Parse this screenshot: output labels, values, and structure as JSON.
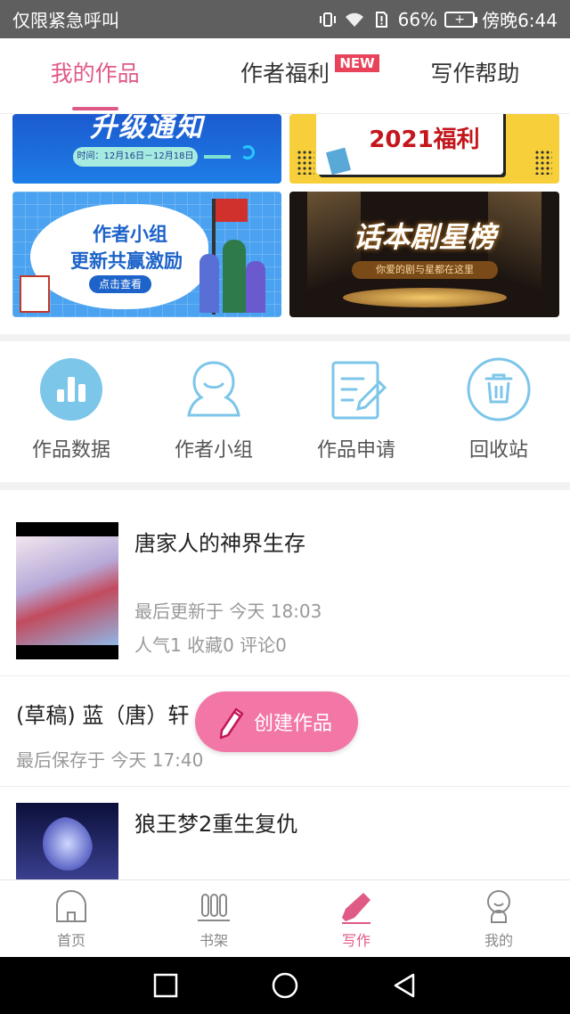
{
  "status_bar": {
    "carrier_text": "仅限紧急呼叫",
    "battery_percent": "66%",
    "time": "傍晚6:44"
  },
  "top_tabs": [
    {
      "label": "我的作品",
      "active": true
    },
    {
      "label": "作者福利",
      "badge": "NEW",
      "active": false
    },
    {
      "label": "写作帮助",
      "active": false
    }
  ],
  "banners": {
    "b1": {
      "title": "升级通知",
      "date": "时间：12月16日－12月18日"
    },
    "b2": {
      "title": "2021福利"
    },
    "b3": {
      "line1": "作者小组",
      "line2": "更新共赢激励",
      "cta": "点击查看"
    },
    "b4": {
      "title": "话本剧星榜",
      "subtitle": "你爱的剧与星都在这里"
    }
  },
  "quick_actions": [
    {
      "label": "作品数据",
      "icon": "bar-chart-icon"
    },
    {
      "label": "作者小组",
      "icon": "person-group-icon"
    },
    {
      "label": "作品申请",
      "icon": "edit-document-icon"
    },
    {
      "label": "回收站",
      "icon": "trash-icon"
    }
  ],
  "works": [
    {
      "title": "唐家人的神界生存",
      "updated": "最后更新于 今天 18:03",
      "stats": "人气1 收藏0 评论0"
    },
    {
      "title": "(草稿) 蓝（唐）轩",
      "updated": "最后保存于 今天 17:40"
    },
    {
      "title": "狼王梦2重生复仇"
    }
  ],
  "fab": {
    "label": "创建作品",
    "icon": "pencil-icon"
  },
  "bottom_nav": [
    {
      "label": "首页",
      "icon": "home-icon",
      "active": false
    },
    {
      "label": "书架",
      "icon": "bookshelf-icon",
      "active": false
    },
    {
      "label": "写作",
      "icon": "pen-icon",
      "active": true
    },
    {
      "label": "我的",
      "icon": "profile-icon",
      "active": false
    }
  ],
  "colors": {
    "accent": "#e05a86",
    "fab": "#f276a6",
    "icon_blue": "#7cc6ea",
    "new_badge": "#e8435a"
  }
}
